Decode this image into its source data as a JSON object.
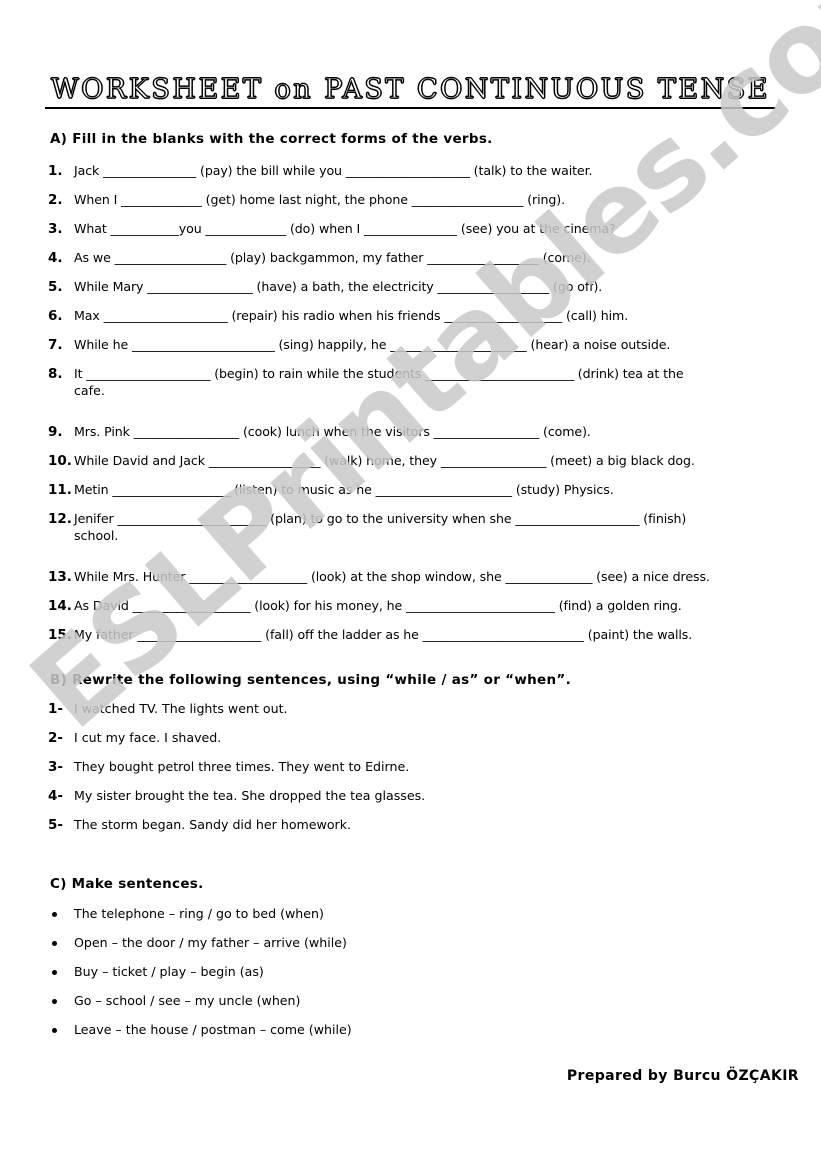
{
  "document": {
    "title": "WORKSHEET  on  PAST  CONTINUOUS  TENSE",
    "watermark": "ESLPrintables.com",
    "footer": "Prepared by Burcu ÖZÇAKIR"
  },
  "sections": {
    "a": {
      "heading": "A) Fill in the blanks with the correct forms of the verbs.",
      "items": [
        {
          "num": "1.",
          "line1": "Jack _______________ (pay) the bill while you ____________________ (talk) to the waiter.",
          "line2": ""
        },
        {
          "num": "2.",
          "line1": "When I _____________ (get) home last night, the phone __________________ (ring).",
          "line2": ""
        },
        {
          "num": "3.",
          "line1": "What ___________you _____________ (do) when I _______________ (see) you at the cinema?",
          "line2": ""
        },
        {
          "num": "4.",
          "line1": "As we __________________ (play) backgammon, my father __________________ (come).",
          "line2": ""
        },
        {
          "num": "5.",
          "line1": "While Mary _________________ (have) a bath, the electricity __________________ (go off).",
          "line2": ""
        },
        {
          "num": "6.",
          "line1": "Max ____________________ (repair) his radio when his friends ___________________ (call) him.",
          "line2": ""
        },
        {
          "num": "7.",
          "line1": "While he _______________________ (sing) happily, he ______________________ (hear) a noise outside.",
          "line2": ""
        },
        {
          "num": "8.",
          "line1": "It ____________________ (begin) to rain while the students ________________________ (drink) tea at the",
          "line2": "cafe."
        },
        {
          "num": "9.",
          "line1": "Mrs. Pink _________________ (cook) lunch when the visitors _________________ (come).",
          "line2": ""
        },
        {
          "num": "10.",
          "line1": "While David and Jack __________________ (walk) home, they _________________ (meet) a big black dog.",
          "line2": ""
        },
        {
          "num": "11.",
          "line1": "Metin ___________________ (listen) to music as he ______________________ (study) Physics.",
          "line2": ""
        },
        {
          "num": "12.",
          "line1": "Jenifer ________________________ (plan) to go to the university when she ____________________ (finish)",
          "line2": "school."
        },
        {
          "num": "13.",
          "line1": "While Mrs. Hunter ___________________ (look) at the shop window, she ______________ (see) a nice dress.",
          "line2": ""
        },
        {
          "num": "14.",
          "line1": "As David ___________________ (look) for his money, he ________________________ (find) a golden ring.",
          "line2": ""
        },
        {
          "num": "15.",
          "line1": "My father ____________________ (fall) off the ladder as he __________________________ (paint) the walls.",
          "line2": ""
        }
      ]
    },
    "b": {
      "heading": "B) Rewrite the following sentences, using “while / as” or “when”.",
      "items": [
        {
          "num": "1-",
          "text": "I watched TV. The lights went out."
        },
        {
          "num": "2-",
          "text": "I cut my face. I shaved."
        },
        {
          "num": "3-",
          "text": "They bought petrol three times. They went to Edirne."
        },
        {
          "num": "4-",
          "text": "My sister brought the tea. She dropped the tea glasses."
        },
        {
          "num": "5-",
          "text": "The storm began. Sandy did her homework."
        }
      ]
    },
    "c": {
      "heading": "C) Make sentences.",
      "items": [
        {
          "text": "The telephone – ring / go to bed (when)"
        },
        {
          "text": "Open – the door / my father – arrive (while)"
        },
        {
          "text": "Buy – ticket / play – begin (as)"
        },
        {
          "text": "Go – school / see – my uncle (when)"
        },
        {
          "text": "Leave – the house / postman – come (while)"
        }
      ]
    }
  }
}
